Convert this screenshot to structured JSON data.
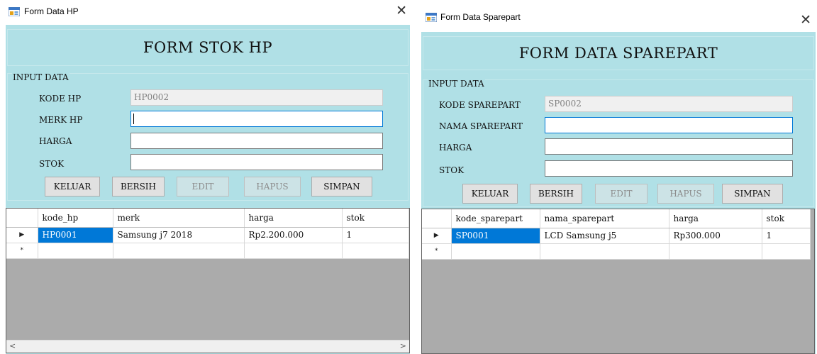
{
  "hp": {
    "window_title": "Form Data HP",
    "close_glyph": "✕",
    "header": "FORM STOK HP",
    "group_label": "INPUT DATA",
    "fields": {
      "kode": {
        "label": "KODE HP",
        "value": "HP0002"
      },
      "merk": {
        "label": "MERK HP",
        "value": ""
      },
      "harga": {
        "label": "HARGA",
        "value": ""
      },
      "stok": {
        "label": "STOK",
        "value": ""
      }
    },
    "buttons": {
      "keluar": "KELUAR",
      "bersih": "BERSIH",
      "edit": "EDIT",
      "hapus": "HAPUS",
      "simpan": "SIMPAN"
    },
    "grid": {
      "columns": [
        "kode_hp",
        "merk",
        "harga",
        "stok"
      ],
      "rows": [
        [
          "HP0001",
          "Samsung j7 2018",
          "Rp2.200.000",
          "1"
        ]
      ],
      "current_row_glyph": "▶",
      "new_row_glyph": "*"
    },
    "scroll_left": "<",
    "scroll_right": ">"
  },
  "sp": {
    "window_title": "Form Data Sparepart",
    "close_glyph": "✕",
    "header": "FORM DATA SPAREPART",
    "group_label": "INPUT DATA",
    "fields": {
      "kode": {
        "label": "KODE SPAREPART",
        "value": "SP0002"
      },
      "nama": {
        "label": "NAMA SPAREPART",
        "value": ""
      },
      "harga": {
        "label": "HARGA",
        "value": ""
      },
      "stok": {
        "label": "STOK",
        "value": ""
      }
    },
    "buttons": {
      "keluar": "KELUAR",
      "bersih": "BERSIH",
      "edit": "EDIT",
      "hapus": "HAPUS",
      "simpan": "SIMPAN"
    },
    "grid": {
      "columns": [
        "kode_sparepart",
        "nama_sparepart",
        "harga",
        "stok"
      ],
      "rows": [
        [
          "SP0001",
          "LCD Samsung j5",
          "Rp300.000",
          "1"
        ]
      ],
      "current_row_glyph": "▶",
      "new_row_glyph": "*"
    }
  },
  "colors": {
    "form_background": "#b0e0e6",
    "selected_cell": "#0078d7",
    "grid_background": "#ababab",
    "disabled_button": "#cce3e6"
  },
  "icons": {
    "app": "form-app-icon",
    "close": "close-icon"
  }
}
